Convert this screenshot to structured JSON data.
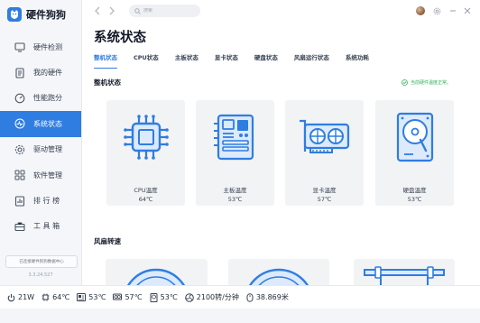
{
  "app": {
    "name": "硬件狗狗",
    "version": "3.3.24.527",
    "version_notice": "已连接硬件狗狗数据中心"
  },
  "sidebar": {
    "items": [
      {
        "label": "硬件检测",
        "icon": "monitor-icon"
      },
      {
        "label": "我的硬件",
        "icon": "document-icon"
      },
      {
        "label": "性能跑分",
        "icon": "gauge-icon"
      },
      {
        "label": "系统状态",
        "icon": "pulse-icon",
        "active": true
      },
      {
        "label": "驱动管理",
        "icon": "gear-icon"
      },
      {
        "label": "软件管理",
        "icon": "grid-icon"
      },
      {
        "label": "排 行 榜",
        "icon": "ranking-icon"
      },
      {
        "label": "工 具 箱",
        "icon": "toolbox-icon"
      }
    ]
  },
  "topbar": {
    "search_placeholder": "搜索"
  },
  "main": {
    "title": "系统状态",
    "tabs": [
      "整机状态",
      "CPU状态",
      "主板状态",
      "显卡状态",
      "硬盘状态",
      "风扇运行状态",
      "系统功耗"
    ],
    "active_tab": "整机状态",
    "section_machine": "整机状态",
    "status_message": "当前硬件温度正常。",
    "cards": [
      {
        "name": "CPU温度",
        "value": "64℃",
        "icon": "cpu-chip-icon"
      },
      {
        "name": "主板温度",
        "value": "53℃",
        "icon": "motherboard-icon"
      },
      {
        "name": "显卡温度",
        "value": "57℃",
        "icon": "graphics-card-icon"
      },
      {
        "name": "硬盘温度",
        "value": "53℃",
        "icon": "hard-disk-icon"
      }
    ],
    "section_fans": "风扇转速"
  },
  "statusbar": {
    "power": "21W",
    "cpu_temp": "64℃",
    "board_temp": "53℃",
    "gpu_temp": "57℃",
    "disk_temp": "53℃",
    "fan_speed": "2100转/分钟",
    "distance": "38.869米"
  },
  "colors": {
    "accent": "#2f7de1",
    "ok": "#2fae57",
    "sidebar_bg": "#f4f6f9",
    "card_bg": "#f2f3f5"
  }
}
